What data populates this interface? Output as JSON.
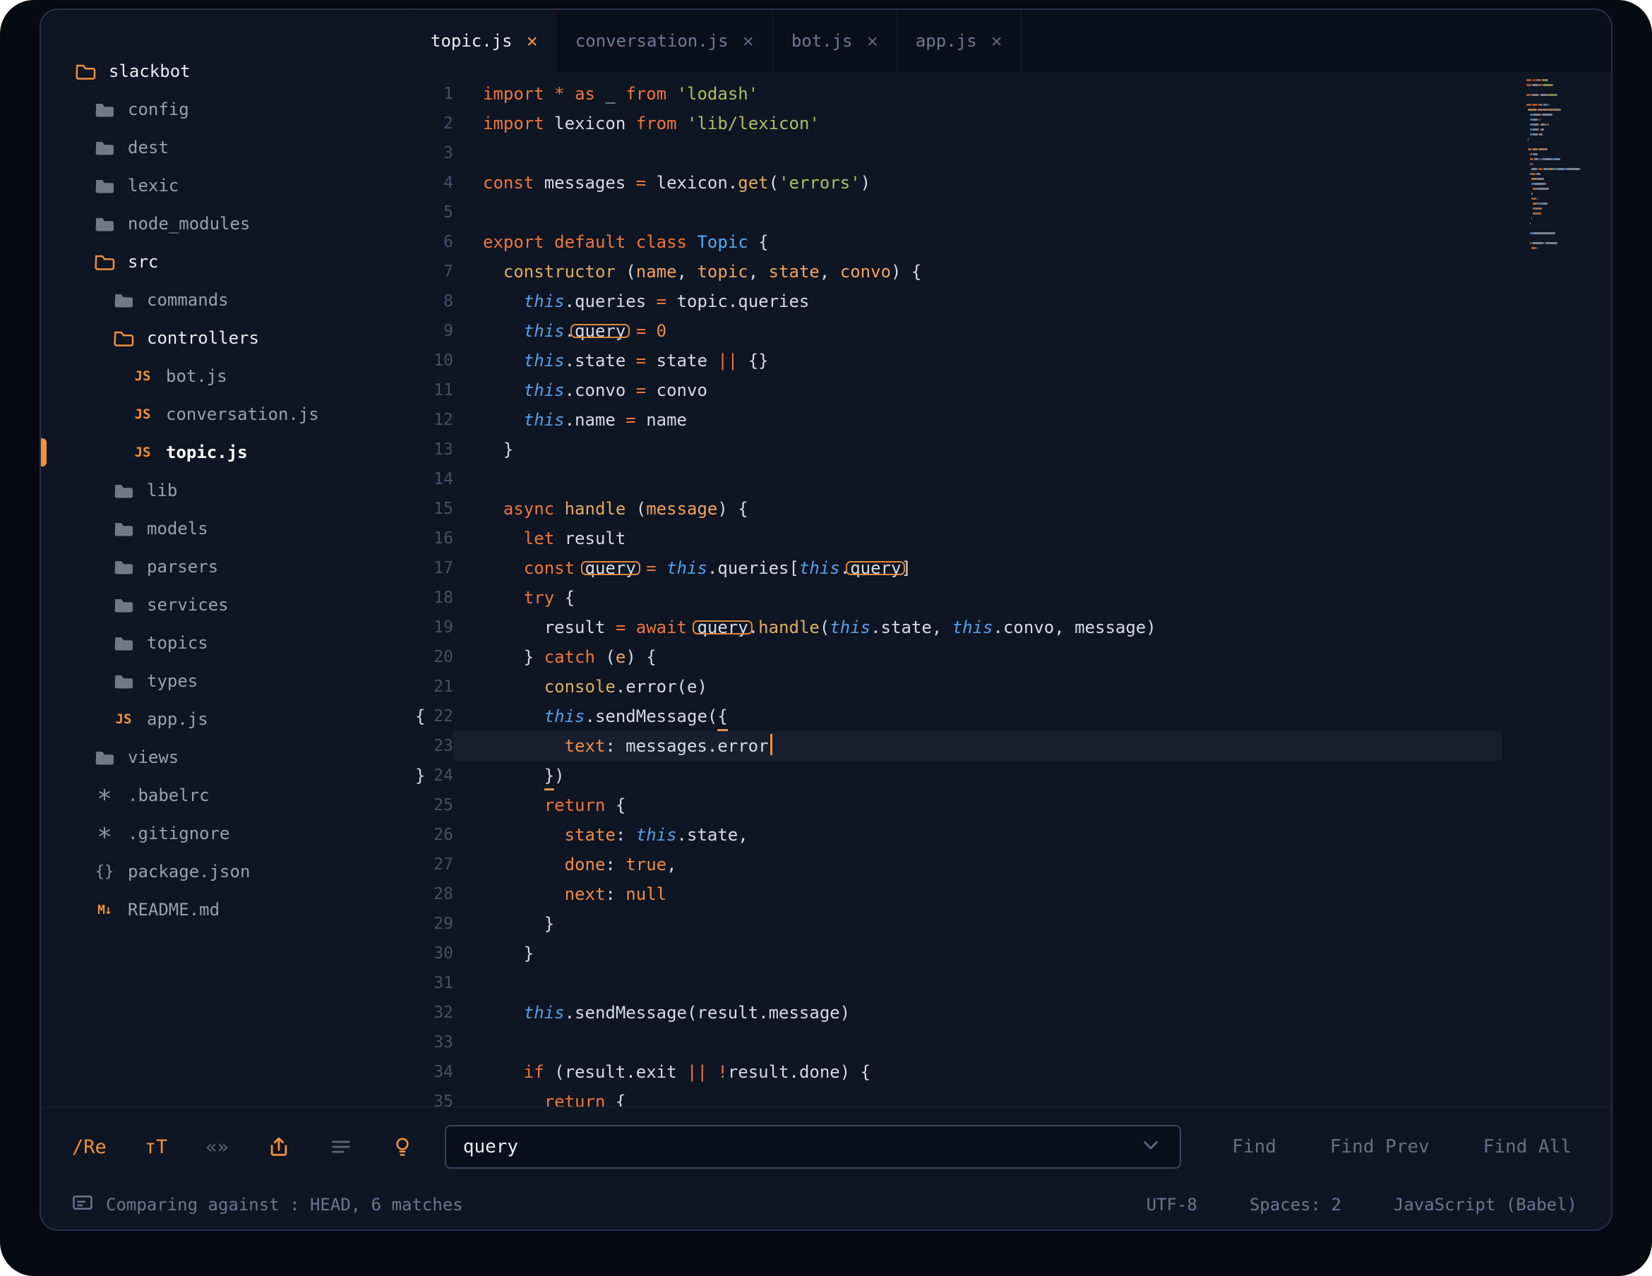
{
  "theme": {
    "accent_orange": "#f0913c",
    "window_bg": "#0e1523",
    "tabstrip_bg": "#0a0f1b",
    "frame_bg": "#070a13",
    "keyword_color": "#f0763c",
    "string_color": "#b3bc61",
    "function_color": "#e0ad61",
    "class_color": "#57a8f0",
    "this_color": "#579fe8",
    "match_border": "#dd8a3e",
    "line_number_color": "#46506b"
  },
  "sidebar": {
    "items": [
      {
        "label": "slackbot",
        "type": "folder-open",
        "level": 0,
        "bright": true
      },
      {
        "label": "config",
        "type": "folder",
        "level": 1
      },
      {
        "label": "dest",
        "type": "folder",
        "level": 1
      },
      {
        "label": "lexic",
        "type": "folder",
        "level": 1
      },
      {
        "label": "node_modules",
        "type": "folder",
        "level": 1
      },
      {
        "label": "src",
        "type": "folder-open",
        "level": 1,
        "bright": true
      },
      {
        "label": "commands",
        "type": "folder",
        "level": 2
      },
      {
        "label": "controllers",
        "type": "folder-open",
        "level": 2,
        "bright": true
      },
      {
        "label": "bot.js",
        "type": "js",
        "level": 3
      },
      {
        "label": "conversation.js",
        "type": "js",
        "level": 3
      },
      {
        "label": "topic.js",
        "type": "js",
        "level": 3,
        "bright": true,
        "active": true
      },
      {
        "label": "lib",
        "type": "folder",
        "level": 2
      },
      {
        "label": "models",
        "type": "folder",
        "level": 2
      },
      {
        "label": "parsers",
        "type": "folder",
        "level": 2
      },
      {
        "label": "services",
        "type": "folder",
        "level": 2
      },
      {
        "label": "topics",
        "type": "folder",
        "level": 2
      },
      {
        "label": "types",
        "type": "folder",
        "level": 2
      },
      {
        "label": "app.js",
        "type": "js",
        "level": 2
      },
      {
        "label": "views",
        "type": "folder",
        "level": 1
      },
      {
        "label": ".babelrc",
        "type": "dotfile",
        "level": 1
      },
      {
        "label": ".gitignore",
        "type": "dotfile",
        "level": 1
      },
      {
        "label": "package.json",
        "type": "json",
        "level": 1
      },
      {
        "label": "README.md",
        "type": "markdown",
        "level": 1
      }
    ]
  },
  "tabs": [
    {
      "label": "topic.js",
      "close": "×",
      "active": true
    },
    {
      "label": "conversation.js",
      "close": "×"
    },
    {
      "label": "bot.js",
      "close": "×"
    },
    {
      "label": "app.js",
      "close": "×"
    }
  ],
  "editor": {
    "current_line": 23,
    "lines": [
      {
        "n": 1,
        "tk": [
          [
            "kw",
            "import"
          ],
          [
            "txt",
            " "
          ],
          [
            "kw",
            "*"
          ],
          [
            "txt",
            " "
          ],
          [
            "kw",
            "as"
          ],
          [
            "txt",
            " _ "
          ],
          [
            "kw",
            "from"
          ],
          [
            "txt",
            " "
          ],
          [
            "str",
            "'lodash'"
          ]
        ]
      },
      {
        "n": 2,
        "tk": [
          [
            "kw",
            "import"
          ],
          [
            "txt",
            " lexicon "
          ],
          [
            "kw",
            "from"
          ],
          [
            "txt",
            " "
          ],
          [
            "str",
            "'lib/lexicon'"
          ]
        ]
      },
      {
        "n": 3,
        "tk": []
      },
      {
        "n": 4,
        "tk": [
          [
            "kw",
            "const"
          ],
          [
            "txt",
            " messages "
          ],
          [
            "kw",
            "="
          ],
          [
            "txt",
            " lexicon."
          ],
          [
            "fn",
            "get"
          ],
          [
            "txt",
            "("
          ],
          [
            "str",
            "'errors'"
          ],
          [
            "txt",
            ")"
          ]
        ]
      },
      {
        "n": 5,
        "tk": []
      },
      {
        "n": 6,
        "tk": [
          [
            "kw",
            "export"
          ],
          [
            "txt",
            " "
          ],
          [
            "kw",
            "default"
          ],
          [
            "txt",
            " "
          ],
          [
            "kw",
            "class"
          ],
          [
            "txt",
            " "
          ],
          [
            "cls",
            "Topic"
          ],
          [
            "txt",
            " {"
          ]
        ]
      },
      {
        "n": 7,
        "tk": [
          [
            "txt",
            "  "
          ],
          [
            "fn",
            "constructor"
          ],
          [
            "txt",
            " ("
          ],
          [
            "param",
            "name"
          ],
          [
            "txt",
            ", "
          ],
          [
            "param",
            "topic"
          ],
          [
            "txt",
            ", "
          ],
          [
            "param",
            "state"
          ],
          [
            "txt",
            ", "
          ],
          [
            "param",
            "convo"
          ],
          [
            "txt",
            ") {"
          ]
        ]
      },
      {
        "n": 8,
        "tk": [
          [
            "txt",
            "    "
          ],
          [
            "this",
            "this"
          ],
          [
            "txt",
            ".queries "
          ],
          [
            "kw",
            "="
          ],
          [
            "txt",
            " topic.queries"
          ]
        ]
      },
      {
        "n": 9,
        "tk": [
          [
            "txt",
            "    "
          ],
          [
            "this",
            "this"
          ],
          [
            "txt",
            "."
          ],
          [
            "txt",
            "query",
            "box"
          ],
          [
            "txt",
            " "
          ],
          [
            "kw",
            "="
          ],
          [
            "txt",
            " "
          ],
          [
            "const",
            "0"
          ]
        ]
      },
      {
        "n": 10,
        "tk": [
          [
            "txt",
            "    "
          ],
          [
            "this",
            "this"
          ],
          [
            "txt",
            ".state "
          ],
          [
            "kw",
            "="
          ],
          [
            "txt",
            " state "
          ],
          [
            "kw",
            "||"
          ],
          [
            "txt",
            " {}"
          ]
        ]
      },
      {
        "n": 11,
        "tk": [
          [
            "txt",
            "    "
          ],
          [
            "this",
            "this"
          ],
          [
            "txt",
            ".convo "
          ],
          [
            "kw",
            "="
          ],
          [
            "txt",
            " convo"
          ]
        ]
      },
      {
        "n": 12,
        "tk": [
          [
            "txt",
            "    "
          ],
          [
            "this",
            "this"
          ],
          [
            "txt",
            ".name "
          ],
          [
            "kw",
            "="
          ],
          [
            "txt",
            " name"
          ]
        ]
      },
      {
        "n": 13,
        "tk": [
          [
            "txt",
            "  }"
          ]
        ]
      },
      {
        "n": 14,
        "tk": []
      },
      {
        "n": 15,
        "tk": [
          [
            "txt",
            "  "
          ],
          [
            "kw",
            "async"
          ],
          [
            "txt",
            " "
          ],
          [
            "fn",
            "handle"
          ],
          [
            "txt",
            " ("
          ],
          [
            "param",
            "message"
          ],
          [
            "txt",
            ") {"
          ]
        ]
      },
      {
        "n": 16,
        "tk": [
          [
            "txt",
            "    "
          ],
          [
            "kw",
            "let"
          ],
          [
            "txt",
            " result"
          ]
        ]
      },
      {
        "n": 17,
        "tk": [
          [
            "txt",
            "    "
          ],
          [
            "kw",
            "const"
          ],
          [
            "txt",
            " "
          ],
          [
            "txt",
            "query",
            "box"
          ],
          [
            "txt",
            " "
          ],
          [
            "kw",
            "="
          ],
          [
            "txt",
            " "
          ],
          [
            "this",
            "this"
          ],
          [
            "txt",
            ".queries["
          ],
          [
            "this",
            "this"
          ],
          [
            "txt",
            "."
          ],
          [
            "txt",
            "query",
            "box"
          ],
          [
            "txt",
            "]"
          ]
        ]
      },
      {
        "n": 18,
        "tk": [
          [
            "txt",
            "    "
          ],
          [
            "kw",
            "try"
          ],
          [
            "txt",
            " {"
          ]
        ]
      },
      {
        "n": 19,
        "tk": [
          [
            "txt",
            "      result "
          ],
          [
            "kw",
            "="
          ],
          [
            "txt",
            " "
          ],
          [
            "kw",
            "await"
          ],
          [
            "txt",
            " "
          ],
          [
            "txt",
            "query",
            "box"
          ],
          [
            "txt",
            "."
          ],
          [
            "fn",
            "handle"
          ],
          [
            "txt",
            "("
          ],
          [
            "this",
            "this"
          ],
          [
            "txt",
            ".state, "
          ],
          [
            "this",
            "this"
          ],
          [
            "txt",
            ".convo, message)"
          ]
        ]
      },
      {
        "n": 20,
        "tk": [
          [
            "txt",
            "    } "
          ],
          [
            "kw",
            "catch"
          ],
          [
            "txt",
            " ("
          ],
          [
            "param",
            "e"
          ],
          [
            "txt",
            ") {"
          ]
        ]
      },
      {
        "n": 21,
        "tk": [
          [
            "txt",
            "      "
          ],
          [
            "cons",
            "console"
          ],
          [
            "txt",
            ".error(e)"
          ]
        ]
      },
      {
        "n": 22,
        "gut": "{",
        "tk": [
          [
            "txt",
            "      "
          ],
          [
            "this",
            "this"
          ],
          [
            "txt",
            ".sendMessage("
          ],
          [
            "txt",
            "{",
            "ul"
          ]
        ]
      },
      {
        "n": 23,
        "cur": true,
        "cursor": true,
        "tk": [
          [
            "txt",
            "        "
          ],
          [
            "prop",
            "text"
          ],
          [
            "txt",
            ": messages.error"
          ]
        ]
      },
      {
        "n": 24,
        "gut": "}",
        "tk": [
          [
            "txt",
            "      "
          ],
          [
            "txt",
            "}",
            "ul"
          ],
          [
            "txt",
            ")"
          ]
        ]
      },
      {
        "n": 25,
        "tk": [
          [
            "txt",
            "      "
          ],
          [
            "kw",
            "return"
          ],
          [
            "txt",
            " {"
          ]
        ]
      },
      {
        "n": 26,
        "tk": [
          [
            "txt",
            "        "
          ],
          [
            "prop",
            "state"
          ],
          [
            "txt",
            ": "
          ],
          [
            "this",
            "this"
          ],
          [
            "txt",
            ".state,"
          ]
        ]
      },
      {
        "n": 27,
        "tk": [
          [
            "txt",
            "        "
          ],
          [
            "prop",
            "done"
          ],
          [
            "txt",
            ": "
          ],
          [
            "const",
            "true"
          ],
          [
            "txt",
            ","
          ]
        ]
      },
      {
        "n": 28,
        "tk": [
          [
            "txt",
            "        "
          ],
          [
            "prop",
            "next"
          ],
          [
            "txt",
            ": "
          ],
          [
            "const",
            "null"
          ]
        ]
      },
      {
        "n": 29,
        "tk": [
          [
            "txt",
            "      }"
          ]
        ]
      },
      {
        "n": 30,
        "tk": [
          [
            "txt",
            "    }"
          ]
        ]
      },
      {
        "n": 31,
        "tk": []
      },
      {
        "n": 32,
        "tk": [
          [
            "txt",
            "    "
          ],
          [
            "this",
            "this"
          ],
          [
            "txt",
            ".sendMessage(result.message)"
          ]
        ]
      },
      {
        "n": 33,
        "tk": []
      },
      {
        "n": 34,
        "tk": [
          [
            "txt",
            "    "
          ],
          [
            "kw",
            "if"
          ],
          [
            "txt",
            " (result.exit "
          ],
          [
            "kw",
            "||"
          ],
          [
            "txt",
            " "
          ],
          [
            "kw",
            "!"
          ],
          [
            "txt",
            "result.done) {"
          ]
        ]
      },
      {
        "n": 35,
        "tk": [
          [
            "txt",
            "      "
          ],
          [
            "kw",
            "return"
          ],
          [
            "txt",
            " {"
          ]
        ]
      }
    ]
  },
  "find_bar": {
    "query": "query",
    "icons": [
      {
        "name": "regex-icon",
        "label": "/Re",
        "active": true
      },
      {
        "name": "match-case-icon",
        "label": "тT",
        "active": true
      },
      {
        "name": "whole-word-icon",
        "label": "«»",
        "active": false
      },
      {
        "name": "wrap-icon",
        "type": "wrap",
        "active": true
      },
      {
        "name": "in-selection-icon",
        "type": "lines",
        "active": false
      },
      {
        "name": "highlight-matches-icon",
        "type": "bulb",
        "active": true
      }
    ],
    "buttons": [
      "Find",
      "Find Prev",
      "Find All"
    ]
  },
  "status_bar": {
    "left": "Comparing against : HEAD, 6 matches",
    "right": [
      "UTF-8",
      "Spaces: 2",
      "JavaScript (Babel)"
    ]
  }
}
